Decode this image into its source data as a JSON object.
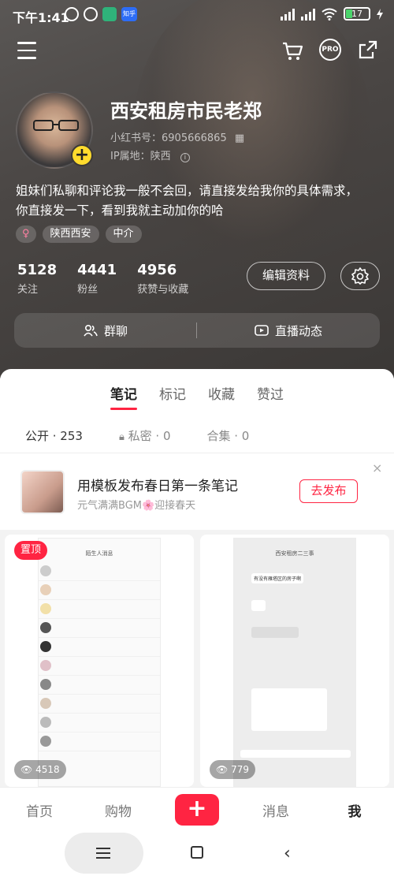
{
  "status_bar": {
    "time": "下午1:41",
    "battery": "17",
    "app_badge": "知乎"
  },
  "profile": {
    "name": "西安租房市民老郑",
    "id_line": "小红书号：6905666865",
    "location_line": "IP属地：陕西",
    "bio_line1": "姐妹们私聊和评论我一般不会回，请直接发给我你的具体需求，",
    "bio_line2": "你直接发一下，看到我就主动加你的哈",
    "tags": [
      "♀",
      "陕西西安",
      "中介"
    ],
    "stats": [
      {
        "num": "5128",
        "label": "关注"
      },
      {
        "num": "4441",
        "label": "粉丝"
      },
      {
        "num": "4956",
        "label": "获赞与收藏"
      }
    ],
    "edit_label": "编辑资料",
    "group_chat_label": "群聊",
    "live_label": "直播动态"
  },
  "content_tabs": [
    "笔记",
    "标记",
    "收藏",
    "赞过"
  ],
  "sub_filters": {
    "public": "公开 · 253",
    "private": "私密 · 0",
    "collection": "合集 · 0"
  },
  "promo": {
    "title": "用模板发布春日第一条笔记",
    "desc": "元气满满BGM🌸迎接春天",
    "button": "去发布",
    "close": "×"
  },
  "cards": [
    {
      "badge": "置顶",
      "views": "4518",
      "screen_title": "陌生人消息"
    },
    {
      "views": "779",
      "screen_title": "西安租房二三事",
      "screen_bubble": "有没有雁塔区的房子啊"
    }
  ],
  "tabbar": {
    "home": "首页",
    "shop": "购物",
    "add": "+",
    "messages": "消息",
    "me": "我"
  },
  "colors": {
    "accent": "#ff2442",
    "badge_yellow": "#ffdb2d"
  }
}
